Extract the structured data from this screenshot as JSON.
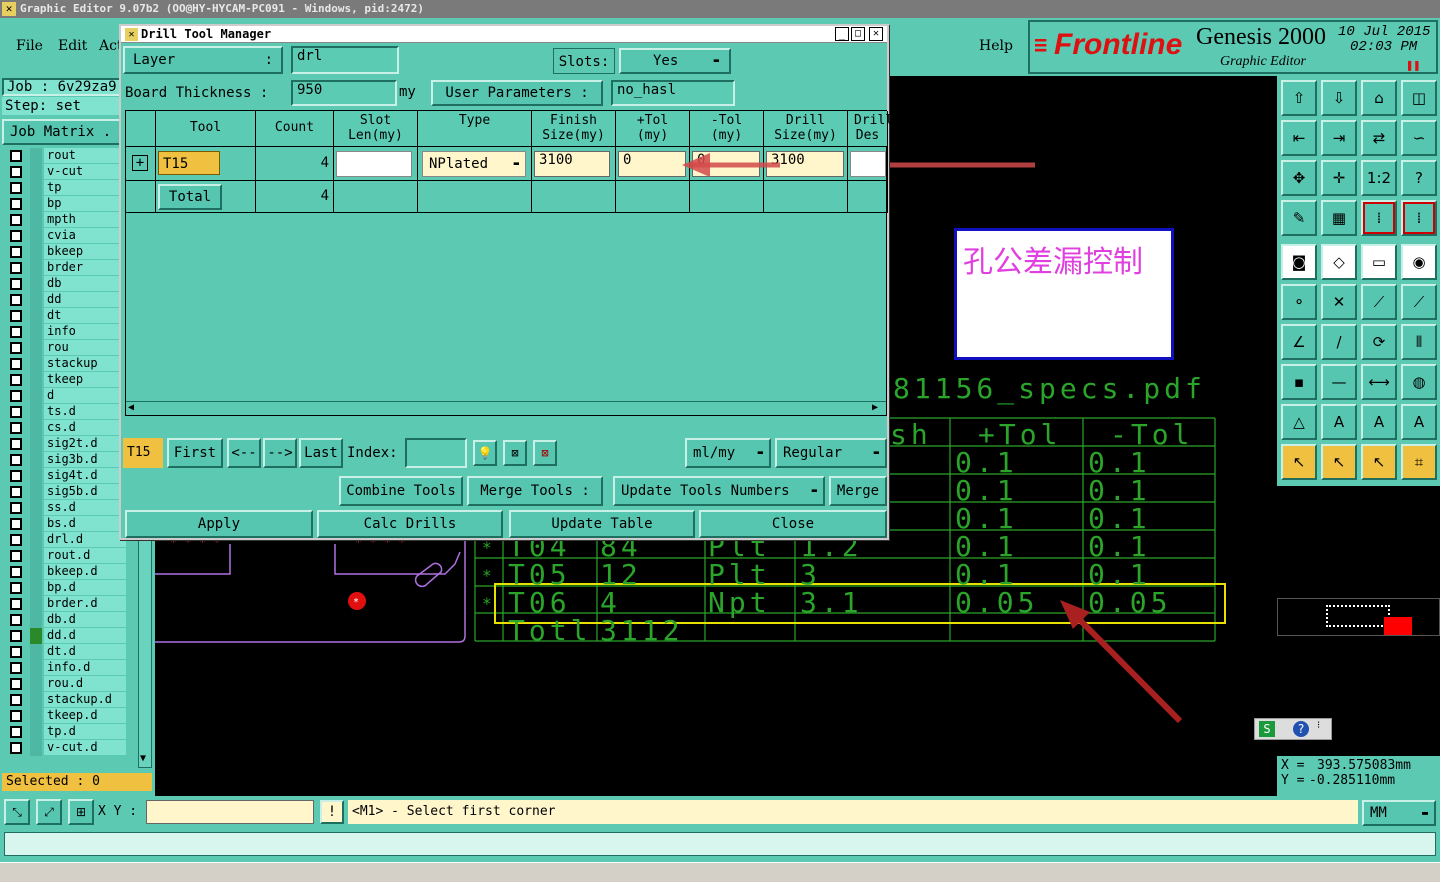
{
  "window": {
    "title": "Graphic Editor 9.07b2 (OO@HY-HYCAM-PC091 - Windows, pid:2472)"
  },
  "menu": {
    "file": "File",
    "edit": "Edit",
    "actions": "Act",
    "help": "Help"
  },
  "brand": {
    "logo": "Frontline",
    "product": "Genesis 2000",
    "subtitle": "Graphic Editor",
    "date": "10 Jul 2015",
    "time": "02:03 PM"
  },
  "left_panel": {
    "job_label": "Job :",
    "job_value": "6v29za9",
    "step_label": "Step:",
    "step_value": "set",
    "job_matrix": "Job Matrix .",
    "layers": [
      "rout",
      "v-cut",
      "tp",
      "bp",
      "mpth",
      "cvia",
      "bkeep",
      "brder",
      "db",
      "dd",
      "dt",
      "info",
      "rou",
      "stackup",
      "tkeep",
      "d",
      "ts.d",
      "cs.d",
      "sig2t.d",
      "sig3b.d",
      "sig4t.d",
      "sig5b.d",
      "ss.d",
      "bs.d",
      "drl.d",
      "rout.d",
      "bkeep.d",
      "bp.d",
      "brder.d",
      "db.d",
      "dd.d",
      "dt.d",
      "info.d",
      "rou.d",
      "stackup.d",
      "tkeep.d",
      "tp.d",
      "v-cut.d"
    ],
    "selected": "Selected : 0"
  },
  "dialog": {
    "title": "Drill Tool Manager",
    "layer_label": "Layer",
    "layer_colon": ":",
    "layer_value": "drl",
    "slots_label": "Slots:",
    "slots_value": "Yes",
    "board_thickness_label": "Board Thickness :",
    "board_thickness_value": "950",
    "board_thickness_unit": "my",
    "user_params_label": "User Parameters :",
    "user_params_value": "no_hasl",
    "columns": [
      "Tool",
      "Count",
      "Slot Len(my)",
      "Type",
      "Finish Size(my)",
      "+Tol (my)",
      "-Tol (my)",
      "Drill Size(my)",
      "Drill Des"
    ],
    "row": {
      "tool": "T15",
      "count": "4",
      "slot_len": "",
      "type": "NPlated",
      "finish": "3100",
      "plus_tol": "0",
      "minus_tol": "0",
      "drill_size": "3100",
      "drill_des": ""
    },
    "total_label": "Total",
    "total_count": "4",
    "nav": {
      "current": "T15",
      "first": "First",
      "prev": "<--",
      "next": "-->",
      "last": "Last",
      "index_label": "Index:",
      "units": "ml/my",
      "mode": "Regular"
    },
    "actions": {
      "combine": "Combine Tools",
      "merge_tools": "Merge Tools :",
      "update_numbers": "Update Tools Numbers",
      "merge": "Merge",
      "apply": "Apply",
      "calc": "Calc Drills",
      "update_table": "Update Table",
      "close": "Close"
    }
  },
  "annotation": {
    "text": "孔公差漏控制"
  },
  "canvas": {
    "pdf_text": "81156_specs.pdf",
    "header_sh": "sh",
    "header_ptol": "+Tol",
    "header_mtol": "-Tol",
    "tol_rows": [
      [
        "0.1",
        "0.1"
      ],
      [
        "0.1",
        "0.1"
      ],
      [
        "0.1",
        "0.1"
      ]
    ],
    "rows": [
      [
        "*",
        "T04",
        "84",
        "Plt",
        "1.2",
        "0.1",
        "0.1"
      ],
      [
        "*",
        "T05",
        "12",
        "Plt",
        "3",
        "0.1",
        "0.1"
      ],
      [
        "*",
        "T06",
        "4",
        "Npt",
        "3.1",
        "0.05",
        "0.05"
      ]
    ],
    "total": [
      "Totl",
      "3112"
    ]
  },
  "coords": {
    "x_label": "X =",
    "x_value": "393.575083mm",
    "y_label": "Y =",
    "y_value": "-0.285110mm"
  },
  "statusbar": {
    "xy_label": "X Y :",
    "xy_value": "",
    "prompt": "<M1> - Select first corner",
    "units": "MM"
  },
  "colors": {
    "teal": "#5cc9b2",
    "annotation_arrow": "#d24a4a",
    "highlight_box": "#e8e000",
    "board_green": "#2aa52a",
    "annotation_text": "#e040e0"
  }
}
